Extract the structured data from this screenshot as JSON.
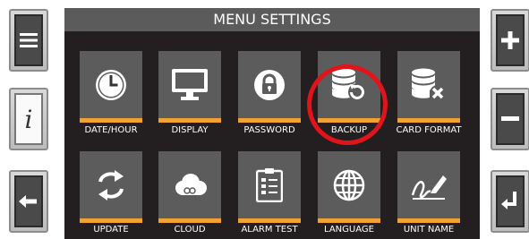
{
  "screen": {
    "title": "MENU SETTINGS"
  },
  "left_buttons": [
    {
      "icon": "hamburger-menu-icon"
    },
    {
      "icon": "info-icon"
    },
    {
      "icon": "arrow-left-icon"
    }
  ],
  "right_buttons": [
    {
      "icon": "plus-icon"
    },
    {
      "icon": "minus-icon"
    },
    {
      "icon": "enter-return-icon"
    }
  ],
  "menu": {
    "row1": [
      {
        "label": "DATE/HOUR",
        "icon": "clock-icon"
      },
      {
        "label": "DISPLAY",
        "icon": "monitor-icon"
      },
      {
        "label": "PASSWORD",
        "icon": "lock-icon"
      },
      {
        "label": "BACKUP",
        "icon": "database-restore-icon"
      },
      {
        "label": "CARD FORMAT",
        "icon": "database-delete-icon"
      }
    ],
    "row2": [
      {
        "label": "UPDATE",
        "icon": "refresh-icon"
      },
      {
        "label": "CLOUD",
        "icon": "cloud-icon"
      },
      {
        "label": "ALARM TEST",
        "icon": "checklist-icon"
      },
      {
        "label": "LANGUAGE",
        "icon": "globe-icon"
      },
      {
        "label": "UNIT NAME",
        "icon": "signature-icon"
      }
    ]
  },
  "highlighted_item": "BACKUP",
  "colors": {
    "screen_bg": "#231f20",
    "title_bar": "#5b5b5b",
    "tile": "#5c5c5c",
    "tile_accent": "#f2a233",
    "highlight": "#e0141a"
  }
}
